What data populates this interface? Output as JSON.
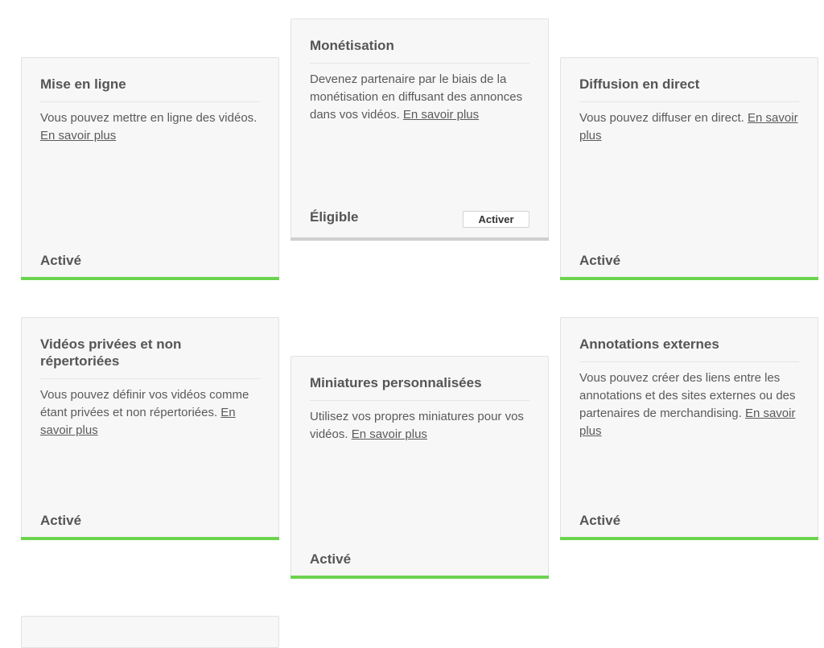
{
  "colors": {
    "enabled_bar": "#6cd34f",
    "eligible_bar": "#cfcfcf"
  },
  "cards": [
    {
      "title": "Mise en ligne",
      "description": "Vous pouvez mettre en ligne des vidéos. ",
      "link": "En savoir plus",
      "status": "Activé"
    },
    {
      "title": "Monétisation",
      "description": "Devenez partenaire par le biais de la monétisation en diffusant des annonces dans vos vidéos. ",
      "link": "En savoir plus",
      "status": "Éligible",
      "button": "Activer"
    },
    {
      "title": "Diffusion en direct",
      "description": "Vous pouvez diffuser en direct. ",
      "link": "En savoir plus",
      "status": "Activé"
    },
    {
      "title": "Vidéos privées et non répertoriées",
      "description": "Vous pouvez définir vos vidéos comme étant privées et non répertoriées. ",
      "link": "En savoir plus",
      "status": "Activé"
    },
    {
      "title": "Miniatures personnalisées",
      "description": "Utilisez vos propres miniatures pour vos vidéos. ",
      "link": "En savoir plus",
      "status": "Activé"
    },
    {
      "title": "Annotations externes",
      "description": "Vous pouvez créer des liens entre les annotations et des sites externes ou des partenaires de merchandising. ",
      "link": "En savoir plus",
      "status": "Activé"
    }
  ]
}
